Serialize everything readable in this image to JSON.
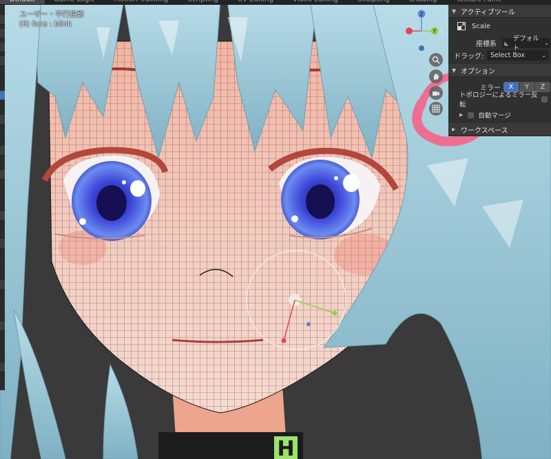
{
  "workspace_tabs": [
    "Default",
    "Game Logic",
    "Motion Tracking",
    "Scripting",
    "UV Editing",
    "Video Editing",
    "Sculpting",
    "Shading",
    "Texture Paint"
  ],
  "viewport": {
    "view_label": "ユーザー・平行投影",
    "object_label": "(6) face : blink"
  },
  "gizmo": {
    "x_axis": "X",
    "y_axis": "Y",
    "z_axis": "Z"
  },
  "npanel": {
    "active_tool_header": "アクティブツール",
    "tool_name": "Scale",
    "orientation_label": "座標系",
    "orientation_value": "デフォルト",
    "drag_label": "ドラッグ:",
    "drag_value": "Select Box",
    "options_header": "オプション",
    "mirror_label": "ミラー",
    "mirror_x": "X",
    "mirror_y": "Y",
    "mirror_z": "Z",
    "topology_mirror_label": "トポロジーによるミラー反転",
    "auto_merge_label": "自動マージ",
    "workspace_header": "ワークスペース"
  },
  "hud_char": "H",
  "colors": {
    "accent": "#4772b3",
    "panel_bg": "#303030",
    "header_bg": "#3a3a3a",
    "hair": "#9fc8d6",
    "skin": "#f1c6b8",
    "iris": "#4a62e0",
    "hairclip": "#ee6e92"
  },
  "icons": {
    "zoom": "magnifier-icon",
    "pan": "hand-icon",
    "camera": "camera-icon",
    "ortho": "grid-icon"
  }
}
